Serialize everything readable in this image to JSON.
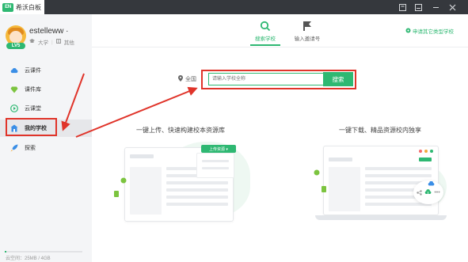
{
  "titlebar": {
    "logo_text": "EN",
    "tab_title": "希沃白板",
    "controls": [
      "window-menu-icon",
      "minimize-icon",
      "maximize-icon",
      "close-icon"
    ]
  },
  "user": {
    "name": "estelleww",
    "dropdown": "·",
    "level": "LV5",
    "school_stage": "大学",
    "subject": "其他"
  },
  "sidebar": {
    "items": [
      {
        "label": "云课件",
        "icon": "cloud-icon"
      },
      {
        "label": "课件库",
        "icon": "diamond-icon"
      },
      {
        "label": "云课堂",
        "icon": "play-circle-icon"
      },
      {
        "label": "我的学校",
        "icon": "school-icon",
        "active": true
      },
      {
        "label": "探索",
        "icon": "rocket-icon"
      }
    ],
    "storage_text": "云空间：25MB / 4GB",
    "storage_fraction": 0.006
  },
  "topnav": {
    "tabs": [
      {
        "label": "搜索学校",
        "icon": "search-icon",
        "active": true
      },
      {
        "label": "输入邀请号",
        "icon": "flag-icon",
        "active": false
      }
    ],
    "apply_link": "申请其它类型学校"
  },
  "search": {
    "region": "全国",
    "placeholder": "请输入学校全称",
    "button": "搜索"
  },
  "features": [
    {
      "caption": "一键上传、快速构建校本资源库",
      "button_label": "上传资源 ▾"
    },
    {
      "caption": "一键下载、精品资源校内独享"
    }
  ],
  "colors": {
    "accent": "#2eb872",
    "annotation": "#e0342a",
    "titlebar": "#35383d",
    "sidebar_bg": "#f4f5f7"
  }
}
